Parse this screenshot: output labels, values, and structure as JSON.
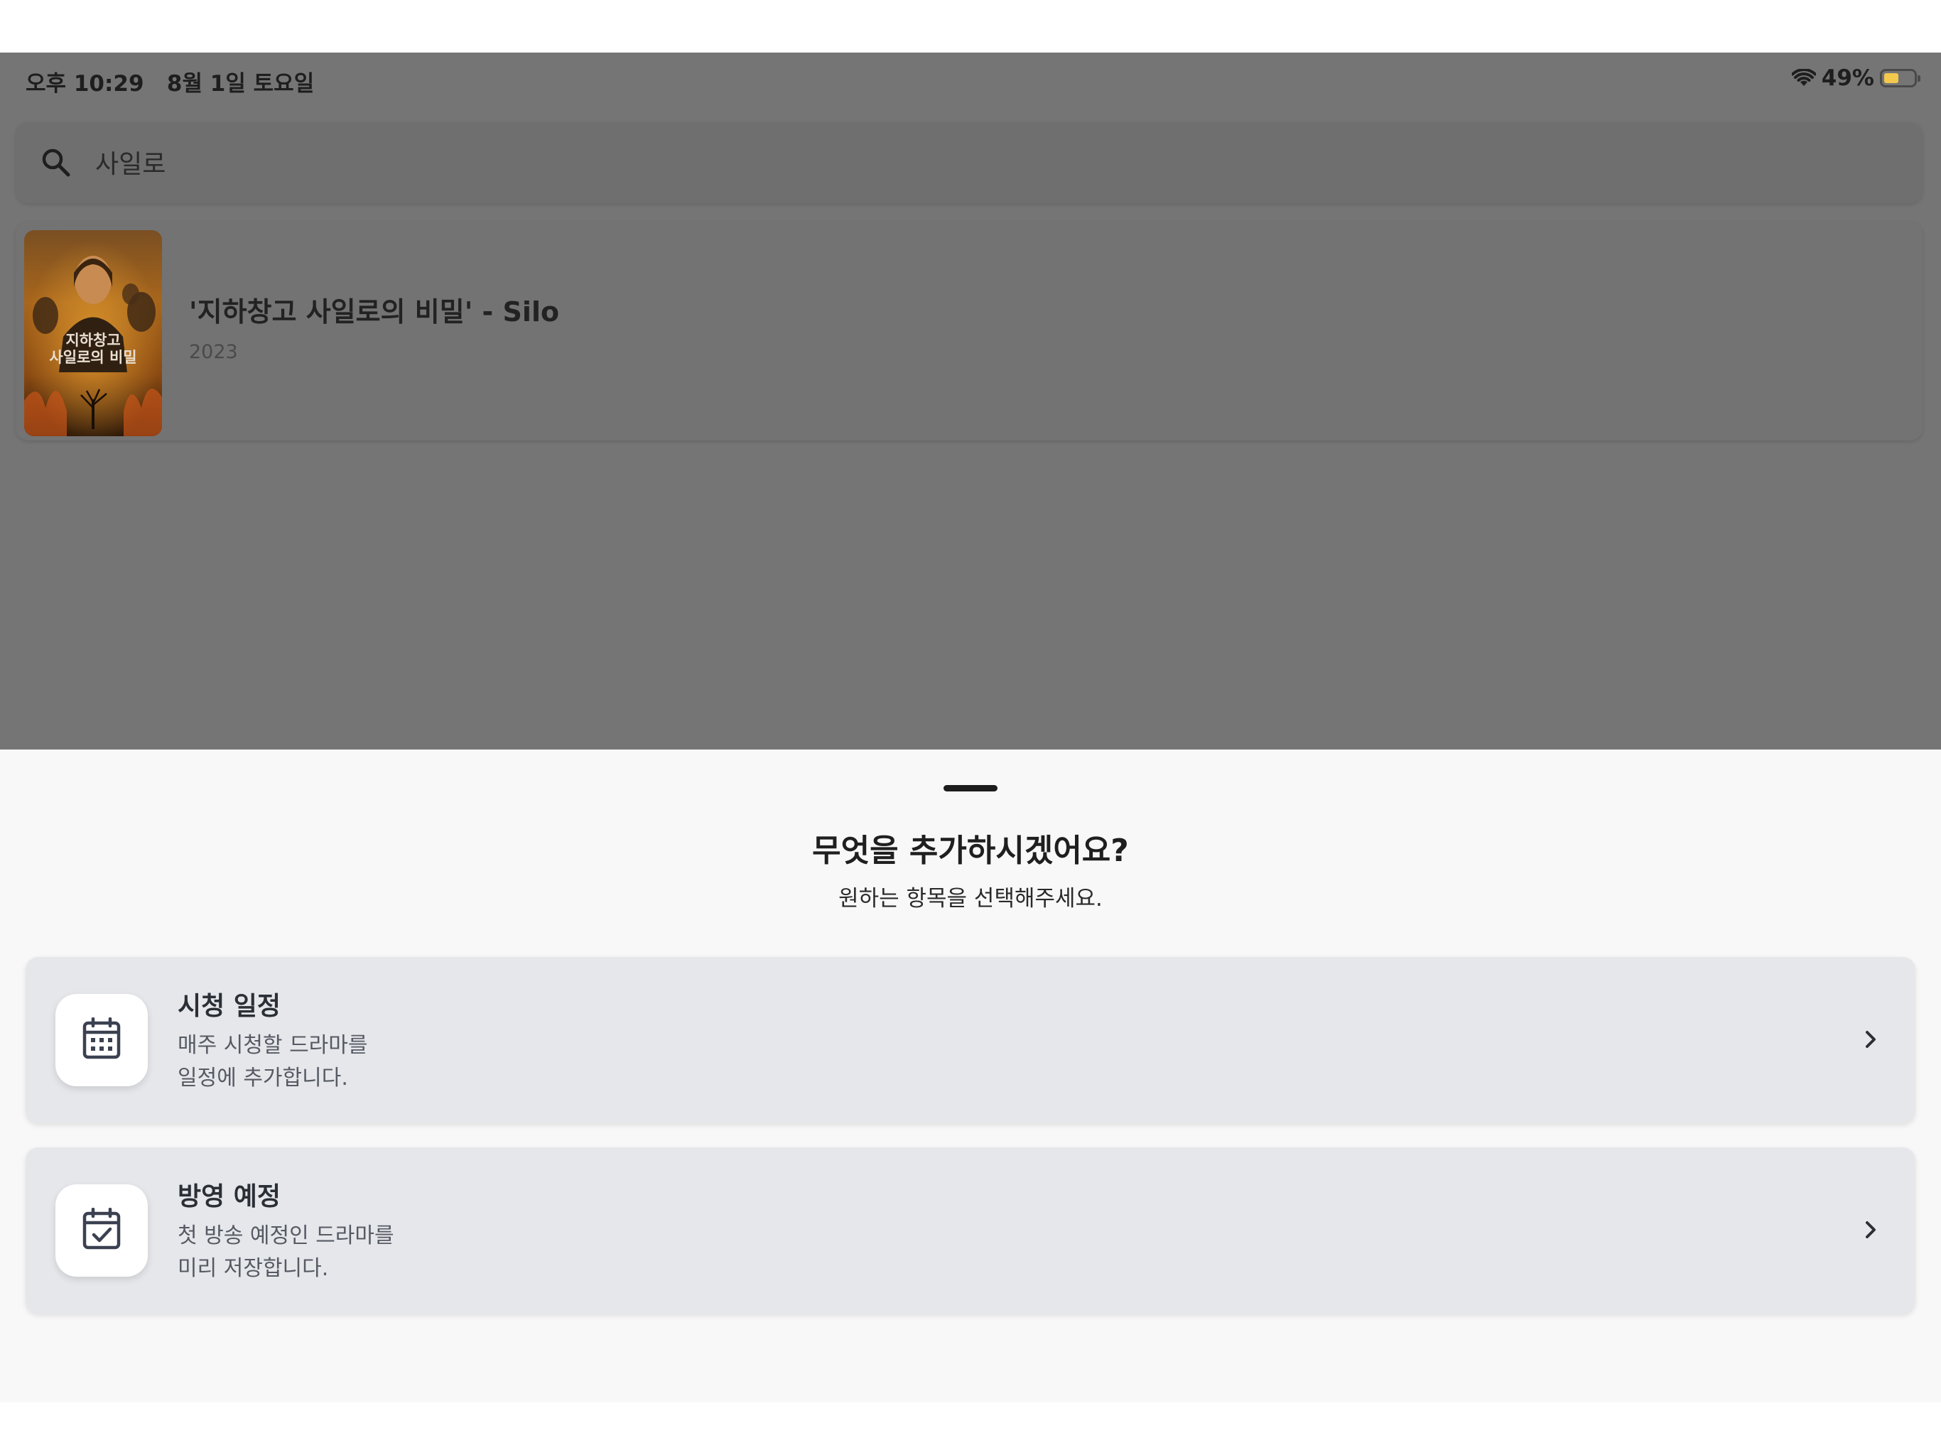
{
  "status_bar": {
    "time_date": "오후 10:29   8월 1일 토요일",
    "battery_percent": "49%",
    "battery_level": 0.49,
    "wifi_icon": "wifi-icon",
    "battery_color": "#f2c94c"
  },
  "search": {
    "query": "사일로",
    "icon": "search-icon"
  },
  "results": [
    {
      "title": "'지하창고 사일로의 비밀' - Silo",
      "year": "2023",
      "poster_text_line1": "지하창고",
      "poster_text_line2": "사일로의 비밀"
    }
  ],
  "sheet": {
    "title": "무엇을 추가하시겠어요?",
    "subtitle": "원하는 항목을 선택해주세요.",
    "options": [
      {
        "title": "시청 일정",
        "desc_line1": "매주 시청할 드라마를",
        "desc_line2": "일정에 추가합니다.",
        "icon": "calendar-grid-icon"
      },
      {
        "title": "방영 예정",
        "desc_line1": "첫 방송 예정인 드라마를",
        "desc_line2": "미리 저장합니다.",
        "icon": "calendar-check-icon"
      }
    ]
  },
  "colors": {
    "dim_overlay": "#757575",
    "sheet_background": "#f8f8f8",
    "option_card": "#e6e7eb",
    "icon_stroke": "#3b4150"
  }
}
